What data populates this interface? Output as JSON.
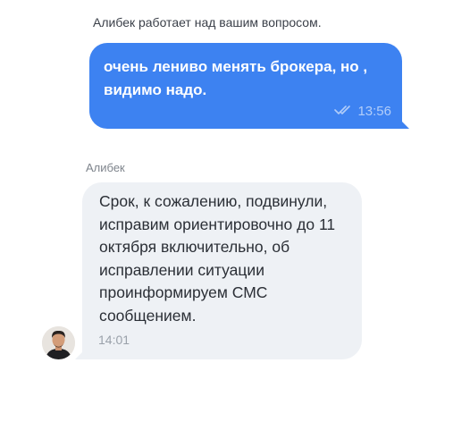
{
  "status": {
    "typing_text": "Алибек работает над вашим вопросом."
  },
  "messages": [
    {
      "direction": "outgoing",
      "text": "очень лениво менять брокера, но , видимо надо.",
      "time": "13:56",
      "read_icon": "double-check-icon",
      "bubble_color": "#3d82f1"
    },
    {
      "direction": "incoming",
      "sender": "Алибек",
      "text": "Срок, к сожалению, подвинули, исправим ориентировочно до 11 октября включительно, об исправлении ситуации проинформируем СМС сообщением.",
      "time": "14:01",
      "avatar_icon": "agent-avatar",
      "bubble_color": "#eef1f5"
    }
  ]
}
